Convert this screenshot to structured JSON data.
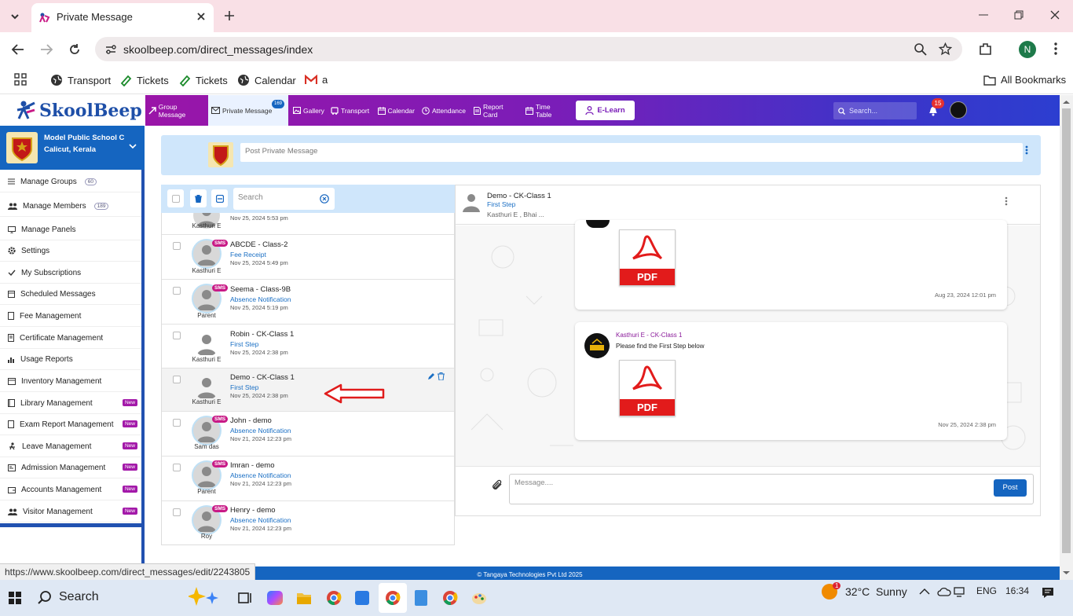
{
  "browser": {
    "tab_title": "Private Message",
    "url": "skoolbeep.com/direct_messages/index",
    "bookmarks": [
      "Transport",
      "Tickets",
      "Tickets",
      "Calendar",
      "a"
    ],
    "all_bookmarks": "All Bookmarks",
    "profile_initial": "N"
  },
  "app": {
    "logo": "SkoolBeep",
    "nav": [
      {
        "label": "Group Message"
      },
      {
        "label": "Private Message",
        "badge": "169"
      },
      {
        "label": "Gallery"
      },
      {
        "label": "Transport"
      },
      {
        "label": "Calendar"
      },
      {
        "label": "Attendance"
      },
      {
        "label": "Report Card"
      },
      {
        "label": "Time Table"
      }
    ],
    "elearn": "E-Learn",
    "search_placeholder": "Search...",
    "notification_count": "15"
  },
  "school": {
    "name": "Model Public School C",
    "location": "Calicut, Kerala"
  },
  "sidebar": [
    {
      "label": "Manage Groups",
      "count": "60"
    },
    {
      "label": "Manage Members",
      "count": "189"
    },
    {
      "label": "Manage Panels"
    },
    {
      "label": "Settings"
    },
    {
      "label": "My Subscriptions"
    },
    {
      "label": "Scheduled Messages"
    },
    {
      "label": "Fee Management"
    },
    {
      "label": "Certificate Management"
    },
    {
      "label": "Usage Reports"
    },
    {
      "label": "Inventory Management"
    },
    {
      "label": "Library Management",
      "new": "New"
    },
    {
      "label": "Exam Report Management",
      "new": "New"
    },
    {
      "label": "Leave Management",
      "new": "New"
    },
    {
      "label": "Admission Management",
      "new": "New"
    },
    {
      "label": "Accounts Management",
      "new": "New"
    },
    {
      "label": "Visitor Management",
      "new": "New"
    }
  ],
  "compose": {
    "placeholder": "Post Private Message"
  },
  "list": {
    "search_placeholder": "Search",
    "rows": [
      {
        "name": "",
        "subject": "",
        "date": "Nov 25, 2024 5:53 pm",
        "sender": "Kasthuri E",
        "sms": false
      },
      {
        "name": "ABCDE - Class-2",
        "subject": "Fee Receipt",
        "date": "Nov 25, 2024 5:49 pm",
        "sender": "Kasthuri E",
        "sms": true
      },
      {
        "name": "Seema - Class-9B",
        "subject": "Absence Notification",
        "date": "Nov 25, 2024 5:19 pm",
        "sender": "Parent",
        "sms": true
      },
      {
        "name": "Robin - CK-Class 1",
        "subject": "First Step",
        "date": "Nov 25, 2024 2:38 pm",
        "sender": "Kasthuri E",
        "sms": false
      },
      {
        "name": "Demo - CK-Class 1",
        "subject": "First Step",
        "date": "Nov 25, 2024 2:38 pm",
        "sender": "Kasthuri E",
        "sms": false
      },
      {
        "name": "John - demo",
        "subject": "Absence Notification",
        "date": "Nov 21, 2024 12:23 pm",
        "sender": "Sam das",
        "sms": true
      },
      {
        "name": "Imran - demo",
        "subject": "Absence Notification",
        "date": "Nov 21, 2024 12:23 pm",
        "sender": "Parent",
        "sms": true
      },
      {
        "name": "Henry - demo",
        "subject": "Absence Notification",
        "date": "Nov 21, 2024 12:23 pm",
        "sender": "Roy",
        "sms": true
      }
    ],
    "sms_label": "SMS"
  },
  "chat": {
    "title": "Demo - CK-Class 1",
    "subject": "First Step",
    "participants": "Kasthuri E , Bhai ...",
    "messages": [
      {
        "sender": "",
        "text": "",
        "attachment": "PDF",
        "time": "Aug 23, 2024 12:01 pm"
      },
      {
        "sender": "Kasthuri E - CK-Class 1",
        "text": "Please find the First Step below",
        "attachment": "PDF",
        "time": "Nov 25, 2024 2:38 pm"
      }
    ],
    "message_placeholder": "Message....",
    "post_label": "Post"
  },
  "footer": "© Tangaya Technologies Pvt Ltd 2025",
  "status_url": "https://www.skoolbeep.com/direct_messages/edit/2243805",
  "taskbar": {
    "search": "Search",
    "weather": "32°C  Sunny",
    "weather_badge": "1",
    "lang": "ENG",
    "time": "16:34"
  }
}
